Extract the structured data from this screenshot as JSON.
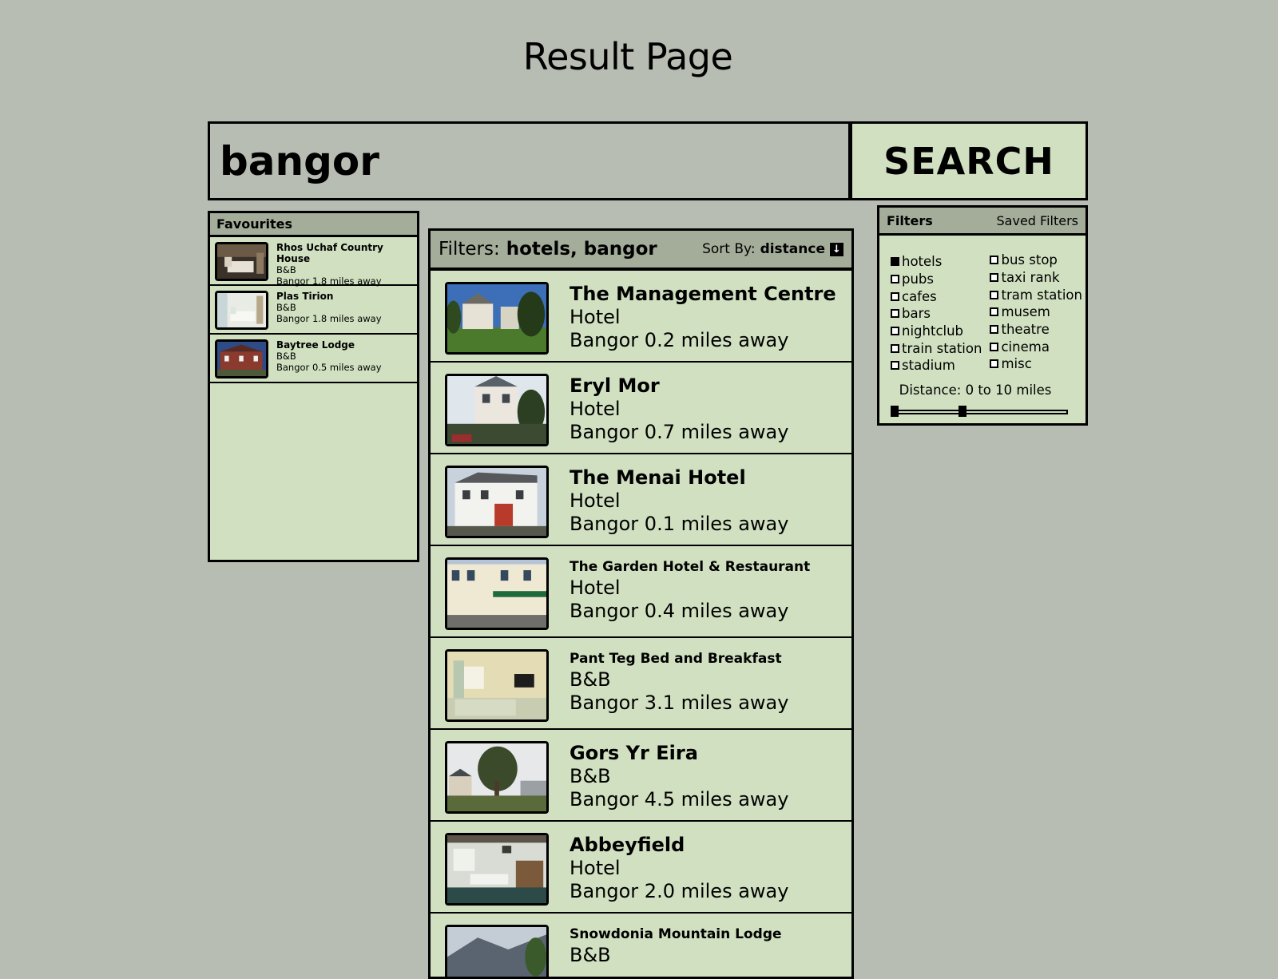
{
  "page": {
    "title": "Result Page"
  },
  "search": {
    "value": "bangor",
    "button_label": "SEARCH"
  },
  "favourites": {
    "header": "Favourites",
    "items": [
      {
        "name": "Rhos Uchaf Country House",
        "type": "B&B",
        "distance": "Bangor 1.8 miles away"
      },
      {
        "name": "Plas Tirion",
        "type": "B&B",
        "distance": "Bangor 1.8 miles away"
      },
      {
        "name": "Baytree Lodge",
        "type": "B&B",
        "distance": "Bangor 0.5 miles away"
      }
    ]
  },
  "results": {
    "filters_label": "Filters:",
    "filters_value": "hotels, bangor",
    "sort_label": "Sort By:",
    "sort_value": "distance",
    "items": [
      {
        "name": "The Management Centre",
        "type": "Hotel",
        "distance": "Bangor 0.2 miles away"
      },
      {
        "name": "Eryl Mor",
        "type": "Hotel",
        "distance": "Bangor 0.7 miles away"
      },
      {
        "name": "The Menai Hotel",
        "type": "Hotel",
        "distance": "Bangor 0.1 miles away"
      },
      {
        "name": "The Garden Hotel & Restaurant",
        "type": "Hotel",
        "distance": "Bangor 0.4 miles away"
      },
      {
        "name": "Pant Teg Bed and Breakfast",
        "type": "B&B",
        "distance": "Bangor 3.1 miles away"
      },
      {
        "name": "Gors Yr Eira",
        "type": "B&B",
        "distance": "Bangor 4.5 miles away"
      },
      {
        "name": "Abbeyfield",
        "type": "Hotel",
        "distance": "Bangor 2.0 miles away"
      },
      {
        "name": "Snowdonia Mountain Lodge",
        "type": "B&B",
        "distance": ""
      }
    ]
  },
  "filters_panel": {
    "title": "Filters",
    "saved_label": "Saved Filters",
    "left": [
      {
        "label": "hotels",
        "checked": true
      },
      {
        "label": "pubs",
        "checked": false
      },
      {
        "label": "cafes",
        "checked": false
      },
      {
        "label": "bars",
        "checked": false
      },
      {
        "label": "nightclub",
        "checked": false
      },
      {
        "label": "train station",
        "checked": false
      },
      {
        "label": "stadium",
        "checked": false
      }
    ],
    "right": [
      {
        "label": "bus stop",
        "checked": false
      },
      {
        "label": "taxi rank",
        "checked": false
      },
      {
        "label": "tram station",
        "checked": false
      },
      {
        "label": "musem",
        "checked": false
      },
      {
        "label": "theatre",
        "checked": false
      },
      {
        "label": "cinema",
        "checked": false
      },
      {
        "label": "misc",
        "checked": false
      }
    ],
    "distance_label": "Distance: 0 to 10 miles",
    "distance_min": 0,
    "distance_max": 10,
    "slider_scale_max": 25
  },
  "colors": {
    "background": "#b7bdb2",
    "panel": "#d0e0c0",
    "header": "#a4ad9a"
  }
}
